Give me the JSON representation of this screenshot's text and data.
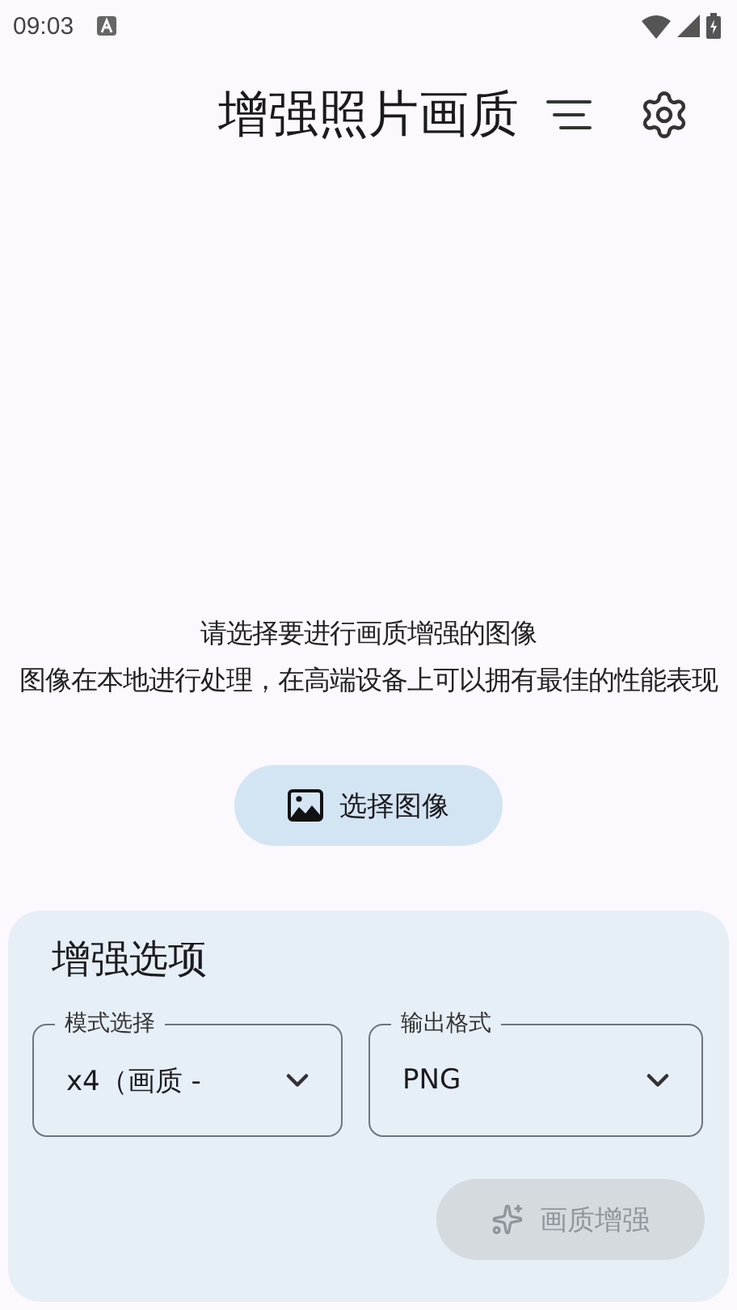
{
  "status_bar": {
    "time": "09:03"
  },
  "app_bar": {
    "title": "增强照片画质"
  },
  "prompt": {
    "heading": "请选择要进行画质增强的图像",
    "note": "图像在本地进行处理，在高端设备上可以拥有最佳的性能表现"
  },
  "select_button": {
    "label": "选择图像"
  },
  "options": {
    "title": "增强选项",
    "fields": [
      {
        "label": "模式选择",
        "value": "x4（画质 -"
      },
      {
        "label": "输出格式",
        "value": "PNG"
      }
    ],
    "enhance_button": {
      "label": "画质增强",
      "disabled": true
    }
  }
}
